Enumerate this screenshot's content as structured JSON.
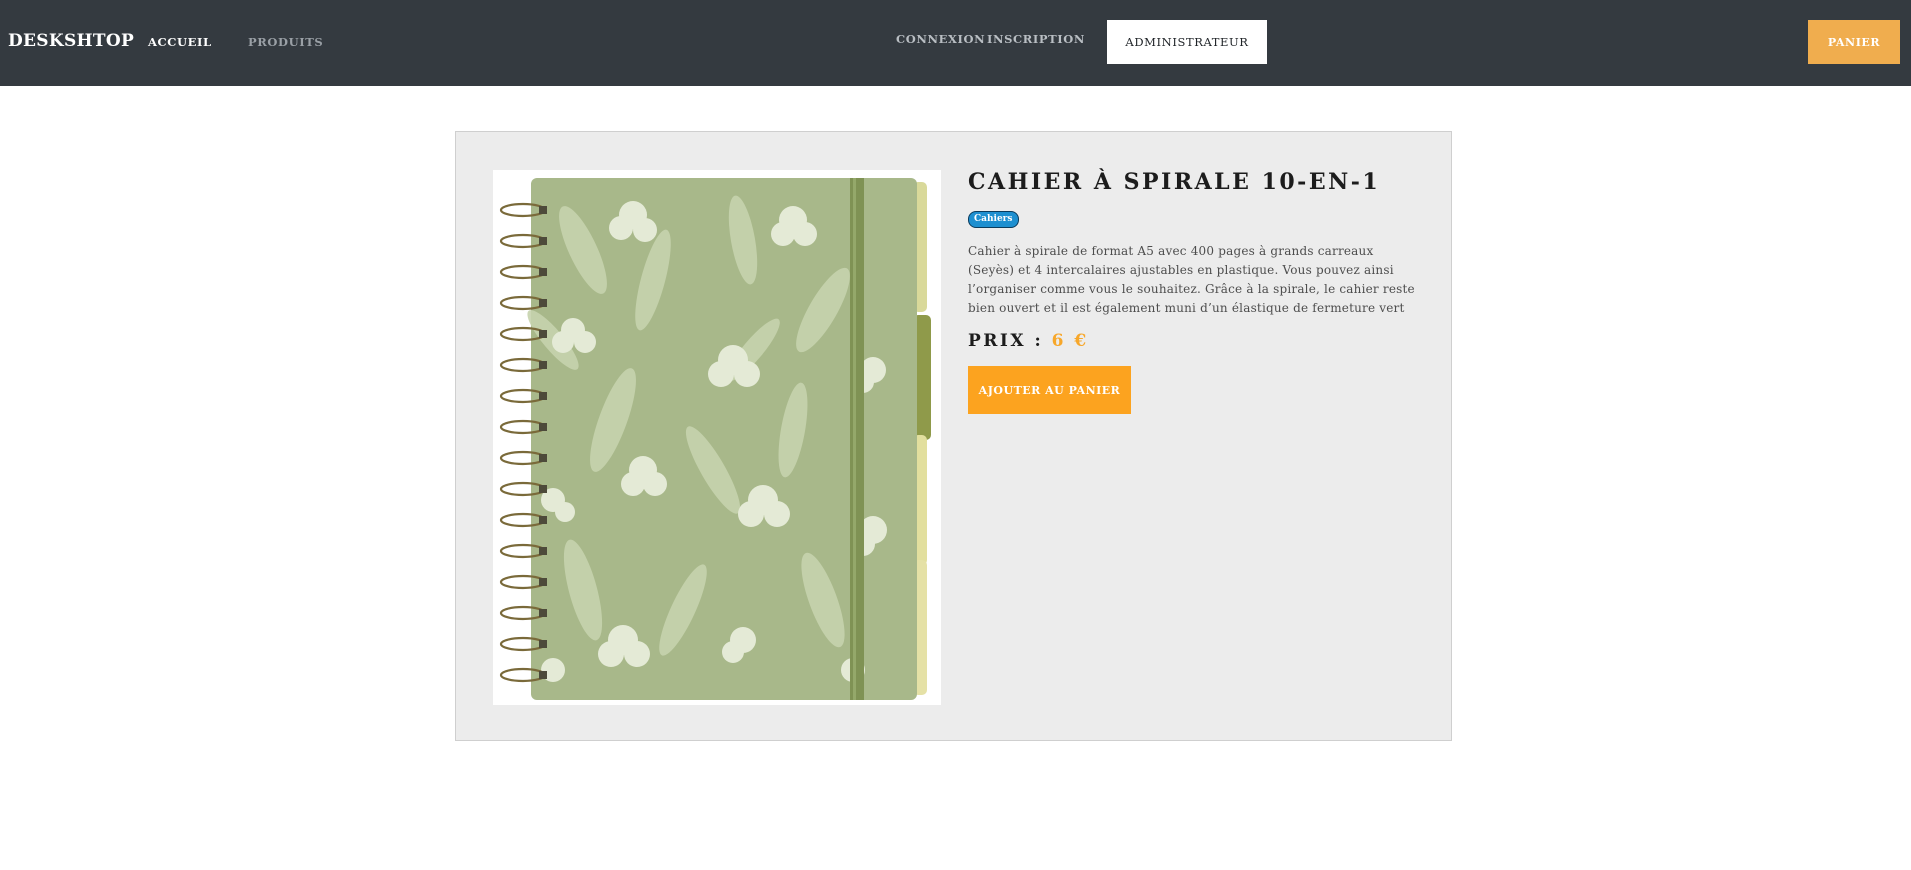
{
  "navbar": {
    "brand": "DESKSHTOP",
    "links": {
      "accueil": "ACCUEIL",
      "produits": "PRODUITS",
      "connexion": "CONNEXION",
      "inscription": "INSCRIPTION"
    },
    "admin_button": "ADMINISTRATEUR",
    "cart_button": "PANIER"
  },
  "product": {
    "title": "CAHIER À SPIRALE 10-EN-1",
    "category_badge": "Cahiers",
    "description": "Cahier à spirale de format A5 avec 400 pages à grands carreaux (Seyès) et 4 intercalaires ajustables en plastique. Vous pouvez ainsi l’organiser comme vous le souhaitez. Grâce à la spirale, le cahier reste bien ouvert et il est également muni d’un élastique de fermeture vert",
    "price_label": "PRIX :",
    "price_value": "6 €",
    "add_to_cart_button": "AJOUTER AU PANIER",
    "image_icon": "spiral-notebook-image"
  },
  "colors": {
    "navbar_bg": "#343a40",
    "cart_button": "#f0ad4e",
    "add_button": "#fca31f",
    "price": "#f7a72a",
    "badge": "#1d8fd0",
    "card_bg": "#ececec"
  }
}
